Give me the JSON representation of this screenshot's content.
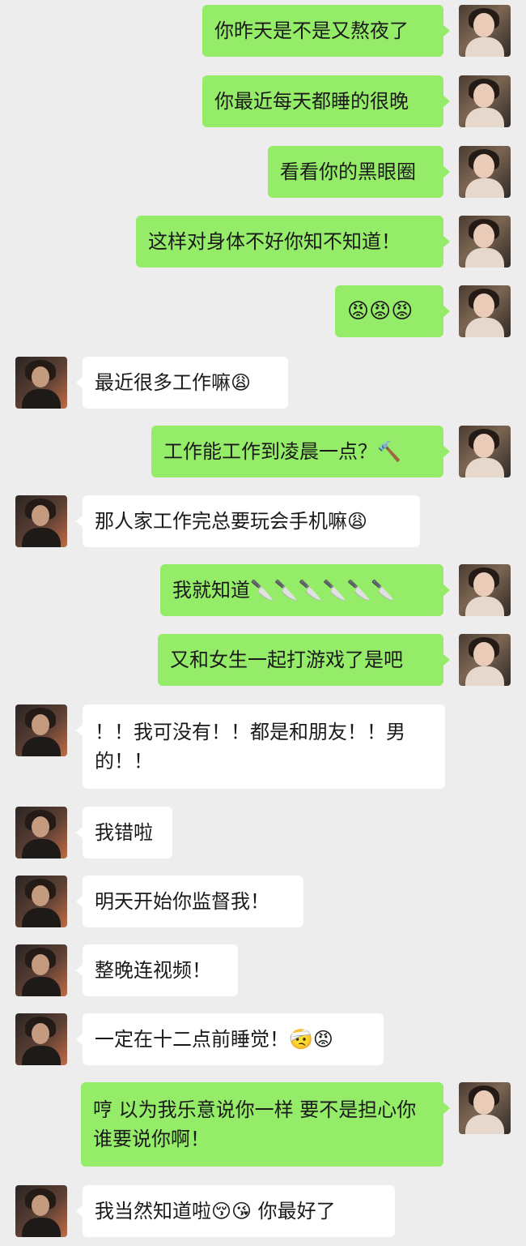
{
  "messages": [
    {
      "side": "right",
      "text": "你昨天是不是又熬夜了"
    },
    {
      "side": "right",
      "text": "你最近每天都睡的很晚"
    },
    {
      "side": "right",
      "text": "看看你的黑眼圈"
    },
    {
      "side": "right",
      "text": "这样对身体不好你知不知道！"
    },
    {
      "side": "right",
      "text": "😡😡😡"
    },
    {
      "side": "left",
      "text": "最近很多工作嘛😩"
    },
    {
      "side": "right",
      "text": "工作能工作到凌晨一点？🔨"
    },
    {
      "side": "left",
      "text": "那人家工作完总要玩会手机嘛😩"
    },
    {
      "side": "right",
      "text": "我就知道🔪🔪🔪🔪🔪🔪"
    },
    {
      "side": "right",
      "text": "又和女生一起打游戏了是吧"
    },
    {
      "side": "left",
      "text": "！！我可没有！！都是和朋友！！男的！！"
    },
    {
      "side": "left",
      "text": "我错啦"
    },
    {
      "side": "left",
      "text": "明天开始你监督我！"
    },
    {
      "side": "left",
      "text": "整晚连视频！"
    },
    {
      "side": "left",
      "text": "一定在十二点前睡觉！🤕😡"
    },
    {
      "side": "right",
      "text": "哼  以为我乐意说你一样  要不是担心你谁要说你啊！"
    },
    {
      "side": "left",
      "text": "我当然知道啦😚😘  你最好了"
    }
  ]
}
